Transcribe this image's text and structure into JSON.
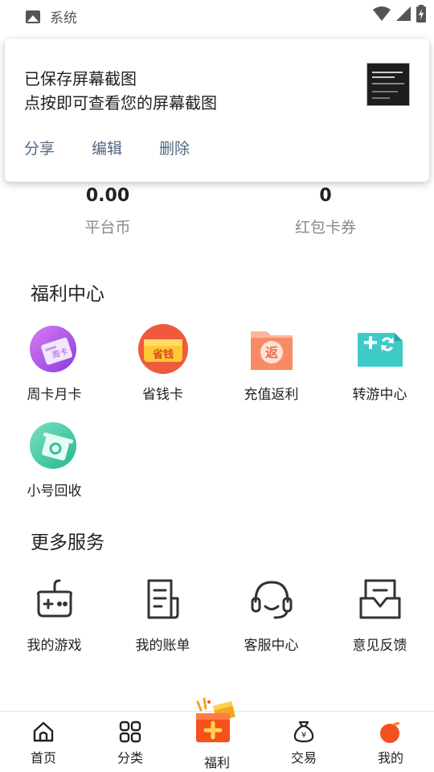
{
  "status_bar": {
    "app_label": "系统"
  },
  "notification": {
    "title": "已保存屏幕截图",
    "subtitle": "点按即可查看您的屏幕截图",
    "actions": {
      "share": "分享",
      "edit": "编辑",
      "delete": "删除"
    }
  },
  "stats": [
    {
      "value": "0.00",
      "label": "平台币"
    },
    {
      "value": "0",
      "label": "红包卡券"
    }
  ],
  "welfare": {
    "title": "福利中心",
    "items": [
      {
        "label": "周卡月卡"
      },
      {
        "label": "省钱卡"
      },
      {
        "label": "充值返利"
      },
      {
        "label": "转游中心"
      },
      {
        "label": "小号回收"
      }
    ],
    "icon_texts": {
      "weekly": "周卡",
      "save": "省钱",
      "rebate": "返"
    }
  },
  "services": {
    "title": "更多服务",
    "items": [
      {
        "label": "我的游戏"
      },
      {
        "label": "我的账单"
      },
      {
        "label": "客服中心"
      },
      {
        "label": "意见反馈"
      }
    ]
  },
  "bottom_nav": {
    "items": [
      {
        "label": "首页"
      },
      {
        "label": "分类"
      },
      {
        "label": "福利"
      },
      {
        "label": "交易"
      },
      {
        "label": "我的"
      }
    ],
    "trade_icon_symbol": "¥"
  },
  "colors": {
    "accent_orange": "#f4511e",
    "action_text": "#51677f",
    "muted_text": "#8a8a8a"
  }
}
